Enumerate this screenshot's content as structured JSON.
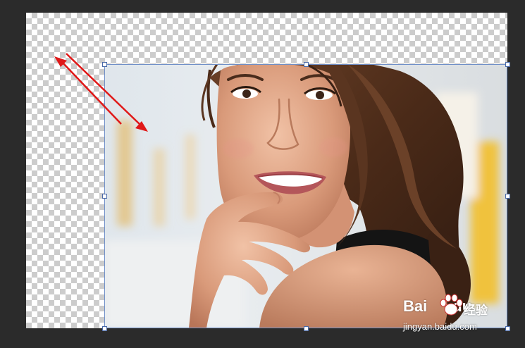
{
  "canvas": {
    "background": "transparency-checkerboard"
  },
  "photo": {
    "subject": "woman-portrait-photo",
    "layer_state": "free-transform-selected"
  },
  "annotation": {
    "arrow_color": "#e01818",
    "arrows": [
      "arrow-up-left-icon",
      "arrow-down-right-icon"
    ]
  },
  "watermark": {
    "brand": "Bai",
    "brand_suffix": "du",
    "product": "经验",
    "url": "jingyan.baidu.com"
  },
  "colors": {
    "workspace_bg": "#2b2b2b",
    "selection_border": "#6f8fc8",
    "handle_fill": "#ffffff"
  }
}
